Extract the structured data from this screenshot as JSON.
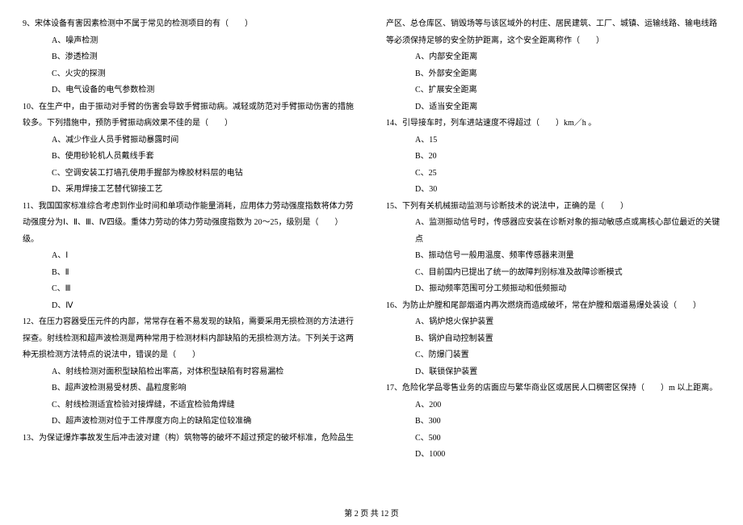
{
  "footer": "第 2 页 共 12 页",
  "left": {
    "q9": {
      "stem": "9、宋体设备有害因素检测中不属于常见的检测项目的有（　　）",
      "opts": [
        "A、噪声检测",
        "B、渗透检测",
        "C、火灾的探测",
        "D、电气设备的电气参数检测"
      ]
    },
    "q10": {
      "stem": "10、在生产中，由于振动对手臂的伤害会导致手臂振动病。减轻或防范对手臂振动伤害的措施较多。下列措施中，预防手臂振动病效果不佳的是（　　）",
      "opts": [
        "A、减少作业人员手臂振动暴露时间",
        "B、使用砂轮机人员戴线手套",
        "C、空调安装工打墙孔使用手握部为橡胶材料层的电钻",
        "D、采用焊接工艺替代铆接工艺"
      ]
    },
    "q11": {
      "stem": "11、我国国家标准综合考虑到作业时间和单项动作能量消耗，应用体力劳动强度指数将体力劳动强度分为Ⅰ、Ⅱ、Ⅲ、Ⅳ四级。重体力劳动的体力劳动强度指数为 20～25，级别是（　　）级。",
      "opts": [
        "A、Ⅰ",
        "B、Ⅱ",
        "C、Ⅲ",
        "D、Ⅳ"
      ]
    },
    "q12": {
      "stem": "12、在压力容器受压元件的内部，常常存在着不易发现的缺陷，需要采用无损检测的方法进行探查。射线检测和超声波检测是两种常用于检测材料内部缺陷的无损检测方法。下列关于这两种无损检测方法特点的说法中，错误的是（　　）",
      "opts": [
        "A、射线检测对面积型缺陷检出率高，对体积型缺陷有时容易漏检",
        "B、超声波检测易受材质、晶粒度影响",
        "C、射线检测适宜检验对接焊缝，不适宜检验角焊缝",
        "D、超声波检测对位于工件厚度方向上的缺陷定位较准确"
      ]
    },
    "q13": {
      "stem": "13、为保证爆炸事故发生后冲击波对建（构）筑物等的破坏不超过预定的破坏标准，危险品生"
    }
  },
  "right": {
    "q13cont": {
      "cont": "产区、总仓库区、销毁场等与该区域外的村庄、居民建筑、工厂、城镇、运输线路、输电线路等必须保持足够的安全防护距离，这个安全距离称作（　　）",
      "opts": [
        "A、内部安全距离",
        "B、外部安全距离",
        "C、扩展安全距离",
        "D、适当安全距离"
      ]
    },
    "q14": {
      "stem": "14、引导接车时，列车进站速度不得超过（　　）km／h 。",
      "opts": [
        "A、15",
        "B、20",
        "C、25",
        "D、30"
      ]
    },
    "q15": {
      "stem": "15、下列有关机械振动监测与诊断技术的说法中，正确的是（　　）",
      "opts": [
        "A、监测振动信号时，传感器应安装在诊断对象的振动敏感点或离核心部位最近的关键点",
        "B、振动信号一般用温度、频率传感器来测量",
        "C、目前国内已提出了统一的故障判别标准及故障诊断模式",
        "D、振动频率范围可分工频振动和低频振动"
      ]
    },
    "q16": {
      "stem": "16、为防止炉膛和尾部烟道内再次燃烧而造成破坏，常在炉膛和烟道易爆处装设（　　）",
      "opts": [
        "A、锅炉熄火保护装置",
        "B、锅炉自动控制装置",
        "C、防爆门装置",
        "D、联锁保护装置"
      ]
    },
    "q17": {
      "stem": "17、危险化学品零售业务的店面应与繁华商业区或居民人口稠密区保持（　　）m 以上距离。",
      "opts": [
        "A、200",
        "B、300",
        "C、500",
        "D、1000"
      ]
    }
  }
}
